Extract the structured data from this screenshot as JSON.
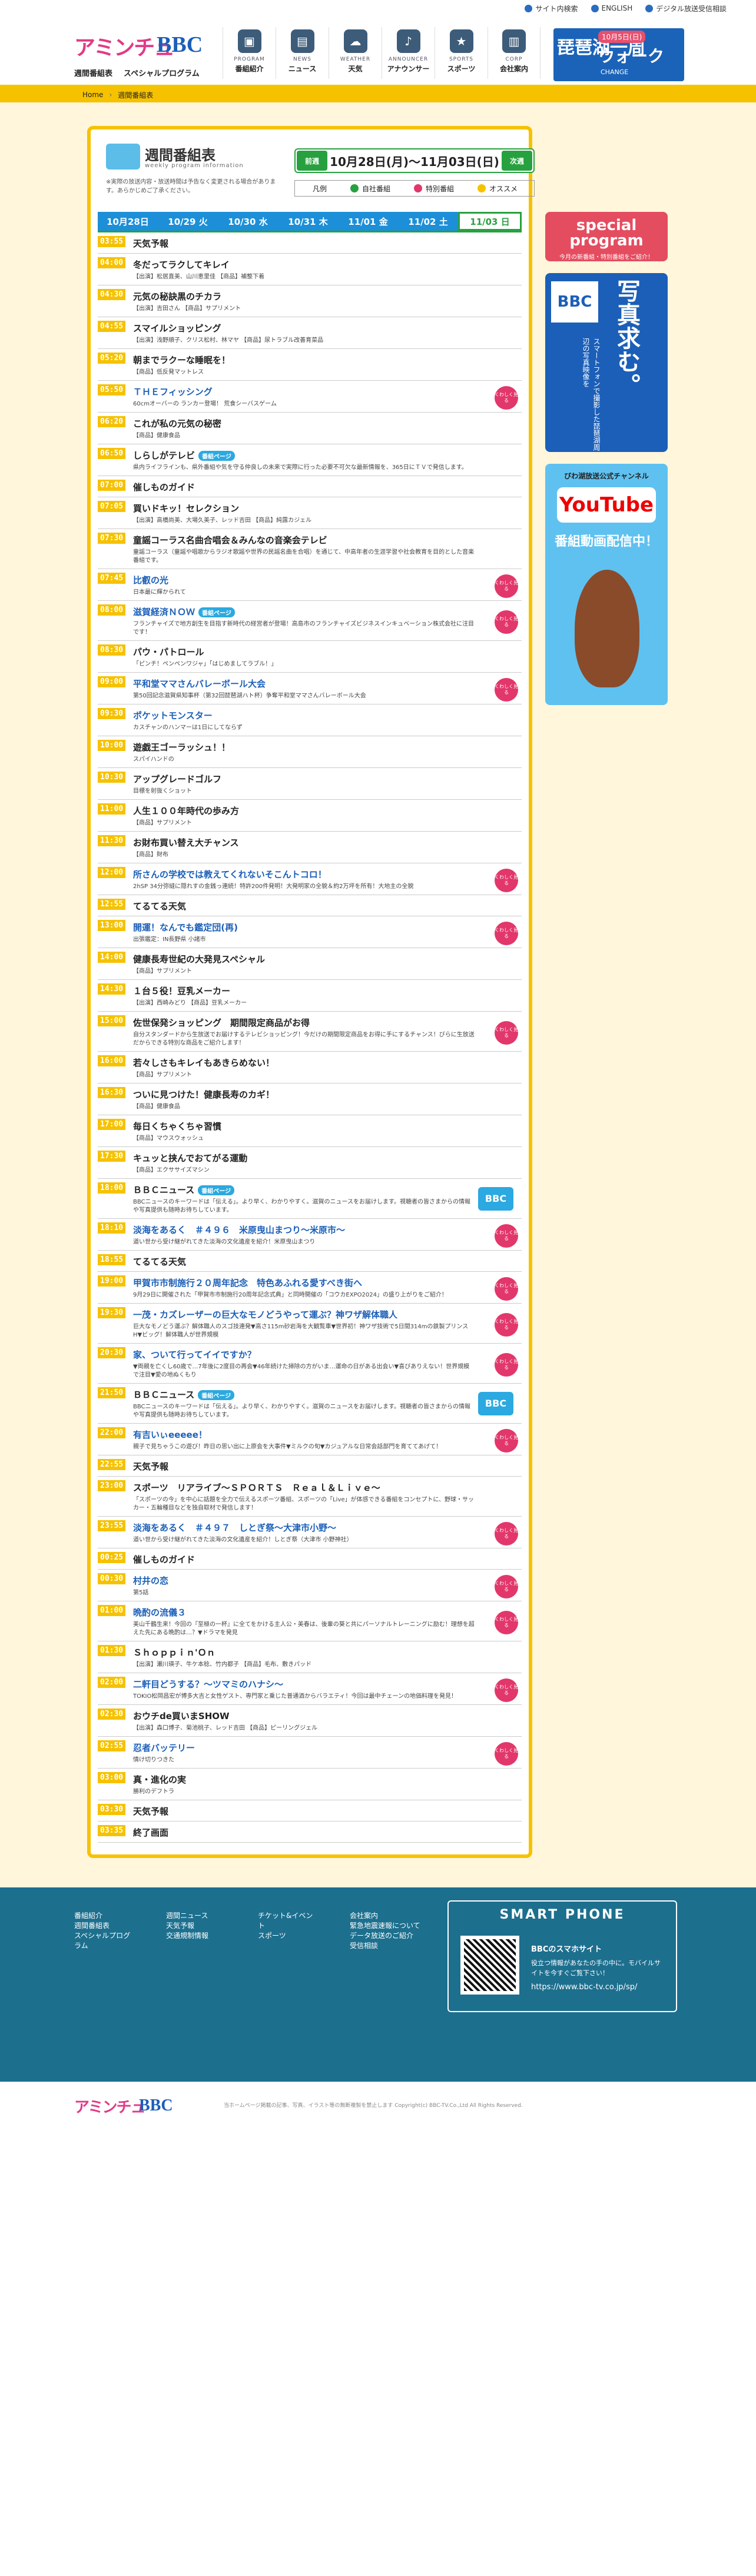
{
  "topbar": {
    "items": [
      "サイト内検索",
      "ENGLISH",
      "デジタル放送受信相談"
    ]
  },
  "header": {
    "logo_text1": "アミンチュ",
    "logo_text2": "BBC",
    "sub_left": "週間番組表",
    "sub_right": "スペシャルプログラム",
    "nav": [
      {
        "en": "PROGRAM",
        "ja": "番組紹介"
      },
      {
        "en": "NEWS",
        "ja": "ニュース"
      },
      {
        "en": "WEATHER",
        "ja": "天気"
      },
      {
        "en": "ANNOUNCER",
        "ja": "アナウンサー"
      },
      {
        "en": "SPORTS",
        "ja": "スポーツ"
      },
      {
        "en": "CORP",
        "ja": "会社案内"
      }
    ],
    "banner": {
      "main": "琵琶湖一周",
      "tag": "10月5日(日)",
      "sub": "ウォーク",
      "small": "CHANGE"
    }
  },
  "breadcrumb": [
    "Home",
    "週間番組表"
  ],
  "schedule": {
    "title": "週間番組表",
    "subtitle": "weekly program information",
    "note": "※実際の放送内容・放送時間は予告なく変更される場合があります。あらかじめご了承ください。",
    "prev": "前週",
    "next": "次週",
    "range": "10月28日(月)～11月03日(日)",
    "legend_title": "凡例",
    "legend": [
      {
        "label": "自社番組",
        "color": "#27a13f"
      },
      {
        "label": "特別番組",
        "color": "#e2376b"
      },
      {
        "label": "オススメ",
        "color": "#f6c200"
      }
    ],
    "tabs": [
      "10月28日",
      "10/29 火",
      "10/30 水",
      "10/31 木",
      "11/01 金",
      "11/02 土",
      "11/03 日"
    ],
    "programs": [
      {
        "time": "03:55",
        "title": "天気予報",
        "desc": ""
      },
      {
        "time": "04:00",
        "title": "冬だってラクしてキレイ",
        "desc": "【出演】松居直美、山川恵里佳 【商品】補整下着"
      },
      {
        "time": "04:30",
        "title": "元気の秘訣黒のチカラ",
        "desc": "【出演】吉田さん 【商品】サプリメント"
      },
      {
        "time": "04:55",
        "title": "スマイルショッピング",
        "desc": "【出演】浅野順子、クリス松村、林マヤ 【商品】尿トラブル改善育菜品"
      },
      {
        "time": "05:20",
        "title": "朝までラクーな睡眠を！",
        "desc": "【商品】低反発マットレス"
      },
      {
        "time": "05:50",
        "title": "ＴＨＥフィッシング",
        "desc": "60cmオーバーの ランカー登場！ 荒食シーバスゲーム",
        "blue": true,
        "mark": true
      },
      {
        "time": "06:20",
        "title": "これが私の元気の秘密",
        "desc": "【商品】健康食品"
      },
      {
        "time": "06:50",
        "title": "しらしがテレビ",
        "desc": "県内ライフラインも、県外番組や気を守る仲良しの未来で実際に行った必要不可欠な最新情報を、365日にＴＶで発信します。",
        "badge": "番組ページ",
        "blue": false
      },
      {
        "time": "07:00",
        "title": "催しものガイド",
        "desc": ""
      },
      {
        "time": "07:05",
        "title": "買いドキッ！セレクション",
        "desc": "【出演】高橋尚美、大場久美子、レッド吉田 【商品】純露カジェル"
      },
      {
        "time": "07:30",
        "title": "童謡コーラス名曲合唱会＆みんなの音楽会テレビ",
        "desc": "童謡コーラス（童謡や唱歌からラジオ歌謡や世界の民謡名曲を合唱）を通じて、中高年者の生涯学習や社会教育を目的とした音楽番組です。"
      },
      {
        "time": "07:45",
        "title": "比叡の光",
        "desc": "日本最に輝かられて",
        "blue": true,
        "mark": true
      },
      {
        "time": "08:00",
        "title": "滋賀経済ＮＯＷ",
        "desc": "フランチャイズで地方創生を目指す新時代の経営者が登場！高島市のフランチャイズビジネスインキュベーション株式会社に注目です！",
        "badge": "番組ページ",
        "blue": true,
        "mark": true
      },
      {
        "time": "08:30",
        "title": "パウ・パトロール",
        "desc": "「ピンチ！ペンペンワジャ」「はじめましてラブル！」"
      },
      {
        "time": "09:00",
        "title": "平和堂ママさんバレーボール大会",
        "desc": "第50回記念滋賀県知事杯（第32回琵琶湖ハト杯）争奪平和堂ママさんバレーボール大会",
        "blue": true,
        "mark": true
      },
      {
        "time": "09:30",
        "title": "ポケットモンスター",
        "desc": "カスチャンのハンマーは1日にしてならず",
        "blue": true
      },
      {
        "time": "10:00",
        "title": "遊戯王ゴーラッシュ！！",
        "desc": "スパイハンドの"
      },
      {
        "time": "10:30",
        "title": "アップグレードゴルフ",
        "desc": "目標を射抜くショット"
      },
      {
        "time": "11:00",
        "title": "人生１００年時代の歩み方",
        "desc": "【商品】サプリメント"
      },
      {
        "time": "11:30",
        "title": "お財布買い替え大チャンス",
        "desc": "【商品】財布"
      },
      {
        "time": "12:00",
        "title": "所さんの学校では教えてくれないそこんトコロ！",
        "desc": "2hSP 34分弥縫に隠れすの金銭っ連続！特許200件発明！大発明家の全貌＆約2万坪を所有！大地主の全貌",
        "blue": true,
        "mark": true
      },
      {
        "time": "12:55",
        "title": "てるてる天気",
        "desc": ""
      },
      {
        "time": "13:00",
        "title": "開運！なんでも鑑定団(再)",
        "desc": "出張鑑定：IN長野県 小諸市",
        "blue": true,
        "mark": true
      },
      {
        "time": "14:00",
        "title": "健康長寿世紀の大発見スペシャル",
        "desc": "【商品】サプリメント"
      },
      {
        "time": "14:30",
        "title": "１台５役！豆乳メーカー",
        "desc": "【出演】西崎みどり 【商品】豆乳メーカー"
      },
      {
        "time": "15:00",
        "title": "佐世保発ショッピング　期間限定商品がお得",
        "desc": "自分スタンダードから生放送でお届けするテレビショッピング！今だけの期間限定商品をお得に手にするチャンス！ぴらに生放送だからできる特別な商品をご紹介します！",
        "mark": true
      },
      {
        "time": "16:00",
        "title": "若々しさもキレイもあきらめない！",
        "desc": "【商品】サプリメント"
      },
      {
        "time": "16:30",
        "title": "ついに見つけた！健康長寿のカギ！",
        "desc": "【商品】健康食品"
      },
      {
        "time": "17:00",
        "title": "毎日くちゃくちゃ習慣",
        "desc": "【商品】マウスウォッシュ"
      },
      {
        "time": "17:30",
        "title": "キュッと挟んでおてがる運動",
        "desc": "【商品】エクササイズマシン"
      },
      {
        "time": "18:00",
        "title": "ＢＢＣニュース",
        "desc": "BBCニュースのキーワードは「伝える」。より早く、わかりやすく。滋賀のニュースをお届けします。視聴者の皆さまからの情報や写真提供も随時お待ちしています。",
        "badge": "番組ページ",
        "news": true
      },
      {
        "time": "18:10",
        "title": "淡海をあるく　＃４９６　米原曳山まつり～米原市～",
        "desc": "道い世から受け継がれてきた淡海の文化遺産を紹介！米原曳山まつり",
        "blue": true,
        "mark": true
      },
      {
        "time": "18:55",
        "title": "てるてる天気",
        "desc": ""
      },
      {
        "time": "19:00",
        "title": "甲賀市市制施行２０周年記念　特色あふれる愛すべき街へ",
        "desc": "9月29日に開催された「甲賀市市制施行20周年記念式典」と同時開催の「コウカEXPO2024」の盛り上がりをご紹介！",
        "blue": true,
        "mark": true
      },
      {
        "time": "19:30",
        "title": "一茂・カズレーザーの巨大なモノどうやって運ぶ？神ワザ解体職人",
        "desc": "巨大なモノどう運ぶ？解体職人のスゴ技連発▼高さ115m砂岩海を大観覧車▼世界初！神ワザ技術で5日間314mの鉄製プリンスH▼ビッグ！解体職人が世界規模",
        "blue": true,
        "mark": true
      },
      {
        "time": "20:30",
        "title": "家、ついて行ってイイですか？",
        "desc": "▼両親を亡くし60歳で…7年後に2度目の再会▼46年続けた掃除の方がいま…運命の日がある出会い▼喜びありえない！世界規模で注目▼愛の地ぬくもり",
        "blue": true,
        "mark": true
      },
      {
        "time": "21:50",
        "title": "ＢＢＣニュース",
        "desc": "BBCニュースのキーワードは「伝える」。より早く、わかりやすく。滋賀のニュースをお届けします。視聴者の皆さまからの情報や写真提供も随時お待ちしています。",
        "badge": "番組ページ",
        "news": true
      },
      {
        "time": "22:00",
        "title": "有吉いぃeeeee！",
        "desc": "親子で見ちゃうこの遊び！昨日の思い出に上原会を大事件▼ミルクの旬▼カジュアルな日常会話部門を育ててあげて！",
        "blue": true,
        "mark": true
      },
      {
        "time": "22:55",
        "title": "天気予報",
        "desc": ""
      },
      {
        "time": "23:00",
        "title": "スポーツ　リアライブ～ＳＰＯＲＴＳ　Ｒｅａｌ＆Ｌｉｖｅ～",
        "desc": "「スポーツの今」を中心に話題を全力で伝えるスポーツ番組、スポーツの「Live」が体感できる番組をコンセプトに、野球・サッカー・五輪種目などを独自取材で発信します！"
      },
      {
        "time": "23:55",
        "title": "淡海をあるく　＃４９７　しとぎ祭～大津市小野～",
        "desc": "道い世から受け継がれてきた淡海の文化遺産を紹介！しとぎ祭（大津市 小野神社）",
        "blue": true,
        "mark": true
      },
      {
        "time": "00:25",
        "title": "催しものガイド",
        "desc": ""
      },
      {
        "time": "00:30",
        "title": "村井の恋",
        "desc": "第5話",
        "blue": true,
        "mark": true
      },
      {
        "time": "01:00",
        "title": "晩酌の流儀３",
        "desc": "美山千鶴生来！今回の『至極の一杯』に全てをかける主人公・美春は、後輩の葵と共にパーソナルトレーニングに励む！理想を超えた先にある晩酌は…？▼ドラマを発見",
        "blue": true,
        "mark": true
      },
      {
        "time": "01:30",
        "title": "Ｓｈｏｐｐｉｎ'Ｏｎ",
        "desc": "【出演】瀬川瑛子、牛ケ本稔、竹内都子 【商品】毛布、敷きパッド"
      },
      {
        "time": "02:00",
        "title": "二軒目どうする？～ツマミのハナシ～",
        "desc": "TOKIO松岡昌宏が博多大吉と女性ゲスト、専門家と乗じた普通酒からバラエティ！今回は最中チェーンの地価料理を発見！",
        "blue": true,
        "mark": true
      },
      {
        "time": "02:30",
        "title": "おウチde買いまSHOW",
        "desc": "【出演】森口博子、菊池桃子、レッド吉田 【商品】ピーリングジェル"
      },
      {
        "time": "02:55",
        "title": "忍者バッテリー",
        "desc": "情け切りつきた",
        "blue": true,
        "mark": true
      },
      {
        "time": "03:00",
        "title": "真・進化の実",
        "desc": "勝利のデフトラ"
      },
      {
        "time": "03:30",
        "title": "天気予報",
        "desc": ""
      },
      {
        "time": "03:35",
        "title": "終了画面",
        "desc": ""
      }
    ],
    "mark_text": "くわしく見る",
    "news_label": "ニュース",
    "news_logo": "BBC"
  },
  "side": {
    "special_title": "special program",
    "special_sub": "今月の新番組・特別番組をご紹介！",
    "photo_logo": "BBC",
    "photo_main": "写真求む。",
    "photo_sub": "スマートフォンで撮影した琵琶湖周辺の写真映像を",
    "yt_top": "びわ湖放送公式チャンネル",
    "yt_logo": "YouTube",
    "yt_sub": "番組動画配信中！"
  },
  "footer": {
    "cols": [
      [
        "番組紹介",
        "週間番組表",
        "スペシャルプログラム"
      ],
      [
        "週間ニュース",
        "天気予報",
        "交通規制情報"
      ],
      [
        "チケット&イベント",
        "スポーツ"
      ],
      [
        "会社案内",
        "緊急地震速報について",
        "データ放送のご紹介",
        "受信相談"
      ]
    ],
    "phone_title": "SMART PHONE",
    "phone_desc1": "BBCのスマホサイト",
    "phone_desc2": "役立つ情報があなたの手の中に。モバイルサイトを今すぐご覧下さい！",
    "phone_url": "https://www.bbc-tv.co.jp/sp/",
    "copyright": "当ホームページ掲載の記事、写真、イラスト等の無断複製を禁止します Copyright(c) BBC-TV.Co.,Ltd All Rights Reserved."
  }
}
